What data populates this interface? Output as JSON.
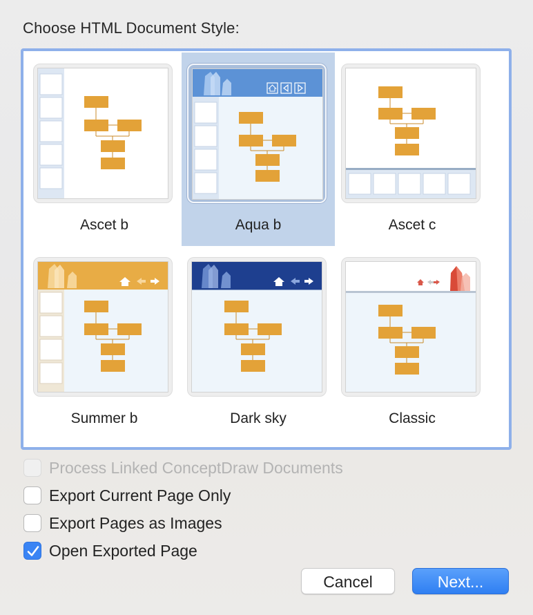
{
  "dialog": {
    "title": "Choose HTML Document Style:"
  },
  "styles": [
    {
      "label": "Ascet b",
      "selected": false
    },
    {
      "label": "Aqua b",
      "selected": true
    },
    {
      "label": "Ascet c",
      "selected": false
    },
    {
      "label": "Summer b",
      "selected": false
    },
    {
      "label": "Dark sky",
      "selected": false
    },
    {
      "label": "Classic",
      "selected": false
    }
  ],
  "options": [
    {
      "label": "Process Linked ConceptDraw Documents",
      "checked": false,
      "disabled": true
    },
    {
      "label": "Export Current Page Only",
      "checked": false,
      "disabled": false
    },
    {
      "label": "Export Pages as Images",
      "checked": false,
      "disabled": false
    },
    {
      "label": "Open Exported Page",
      "checked": true,
      "disabled": false
    }
  ],
  "buttons": {
    "cancel": "Cancel",
    "next": "Next..."
  },
  "colors": {
    "accent": "#3a84f4",
    "selection": "#c1d3ea",
    "chart_box": "#e3a238",
    "aqua_header": "#5c92d6",
    "summer_header": "#e8ac45",
    "darksky_header": "#1e3f8f"
  }
}
